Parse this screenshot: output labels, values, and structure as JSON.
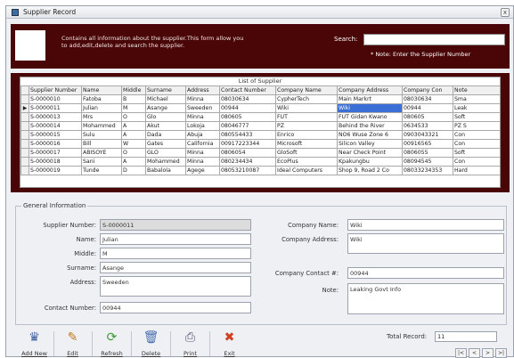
{
  "window": {
    "title": "Supplier Record",
    "close_glyph": "x"
  },
  "header": {
    "description": "Contains all information about the supplier.This form allow you to add,edit,delete and search the supplier.",
    "search_label": "Search:",
    "search_value": "",
    "note": "* Note: Enter the Supplier Number"
  },
  "list": {
    "title": "List of Supplier",
    "columns": [
      "Supplier Number",
      "Name",
      "Middle",
      "Surname",
      "Address",
      "Contact Number",
      "Company Name",
      "Company Address",
      "Company Con",
      "Note"
    ],
    "rows": [
      [
        "S-0000010",
        "Fatoba",
        "B",
        "Michael",
        "Minna",
        "08030634",
        "CypherTech",
        "Main Markrt",
        "08030634",
        "Sma"
      ],
      [
        "S-0000011",
        "Julian",
        "M",
        "Asange",
        "Sweeden",
        "00944",
        "Wiki",
        "Wiki",
        "00944",
        "Leak"
      ],
      [
        "S-0000013",
        "Mrs",
        "O",
        "Glo",
        "Minna",
        "080605",
        "FUT",
        "FUT Gidan Kwano",
        "080605",
        "Soft"
      ],
      [
        "S-0000014",
        "Mohammed",
        "A",
        "Akut",
        "Lokoja",
        "08046777",
        "PZ",
        "Behind the River",
        "0634533",
        "PZ S"
      ],
      [
        "S-0000015",
        "Sulu",
        "A",
        "Dada",
        "Abuja",
        "080554433",
        "Enrico",
        "NO6 Wuse Zone 6",
        "0903043321",
        "Con"
      ],
      [
        "S-0000016",
        "Bill",
        "W",
        "Gates",
        "California",
        "00917223344",
        "Microsoft",
        "Silicon Valley",
        "00916565",
        "Con"
      ],
      [
        "S-0000017",
        "ABISOYE",
        "O",
        "GLO",
        "Minna",
        "0806054",
        "GloSoft",
        "Near Check Point",
        "0806055",
        "Soft"
      ],
      [
        "S-0000018",
        "Sani",
        "A",
        "Mohammed",
        "Minna",
        "080234434",
        "EcoPlus",
        "Kpakungbu",
        "08094545",
        "Con"
      ],
      [
        "S-0000019",
        "Tunde",
        "D",
        "Babalola",
        "Agege",
        "08053210087",
        "Ideal Computers",
        "Shop 9, Road 2 Co",
        "08033234353",
        "Hard"
      ]
    ],
    "selected_row": 1
  },
  "general": {
    "legend": "General Information",
    "supplier_number_label": "Supplier Number:",
    "supplier_number": "S-0000011",
    "name_label": "Name:",
    "name": "Julian",
    "middle_label": "Middle:",
    "middle": "M",
    "surname_label": "Surname:",
    "surname": "Asange",
    "address_label": "Address:",
    "address": "Sweeden",
    "contact_label": "Contact Number:",
    "contact": "00944",
    "company_name_label": "Company Name:",
    "company_name": "Wiki",
    "company_address_label": "Company Address:",
    "company_address": "Wiki",
    "company_contact_label": "Company Contact #:",
    "company_contact": "00944",
    "note_label": "Note:",
    "note": "Leaking Govt Info"
  },
  "toolbar": {
    "add": "Add New",
    "edit": "Edit",
    "refresh": "Refresh",
    "delete": "Delete",
    "print": "Print",
    "exit": "Exit"
  },
  "footer": {
    "total_label": "Total Record:",
    "total": "11",
    "nav_first": "|<",
    "nav_prev": "<",
    "nav_next": ">",
    "nav_last": ">|"
  },
  "colors": {
    "header_bg": "#4a0606",
    "selection": "#3b6fd6"
  }
}
